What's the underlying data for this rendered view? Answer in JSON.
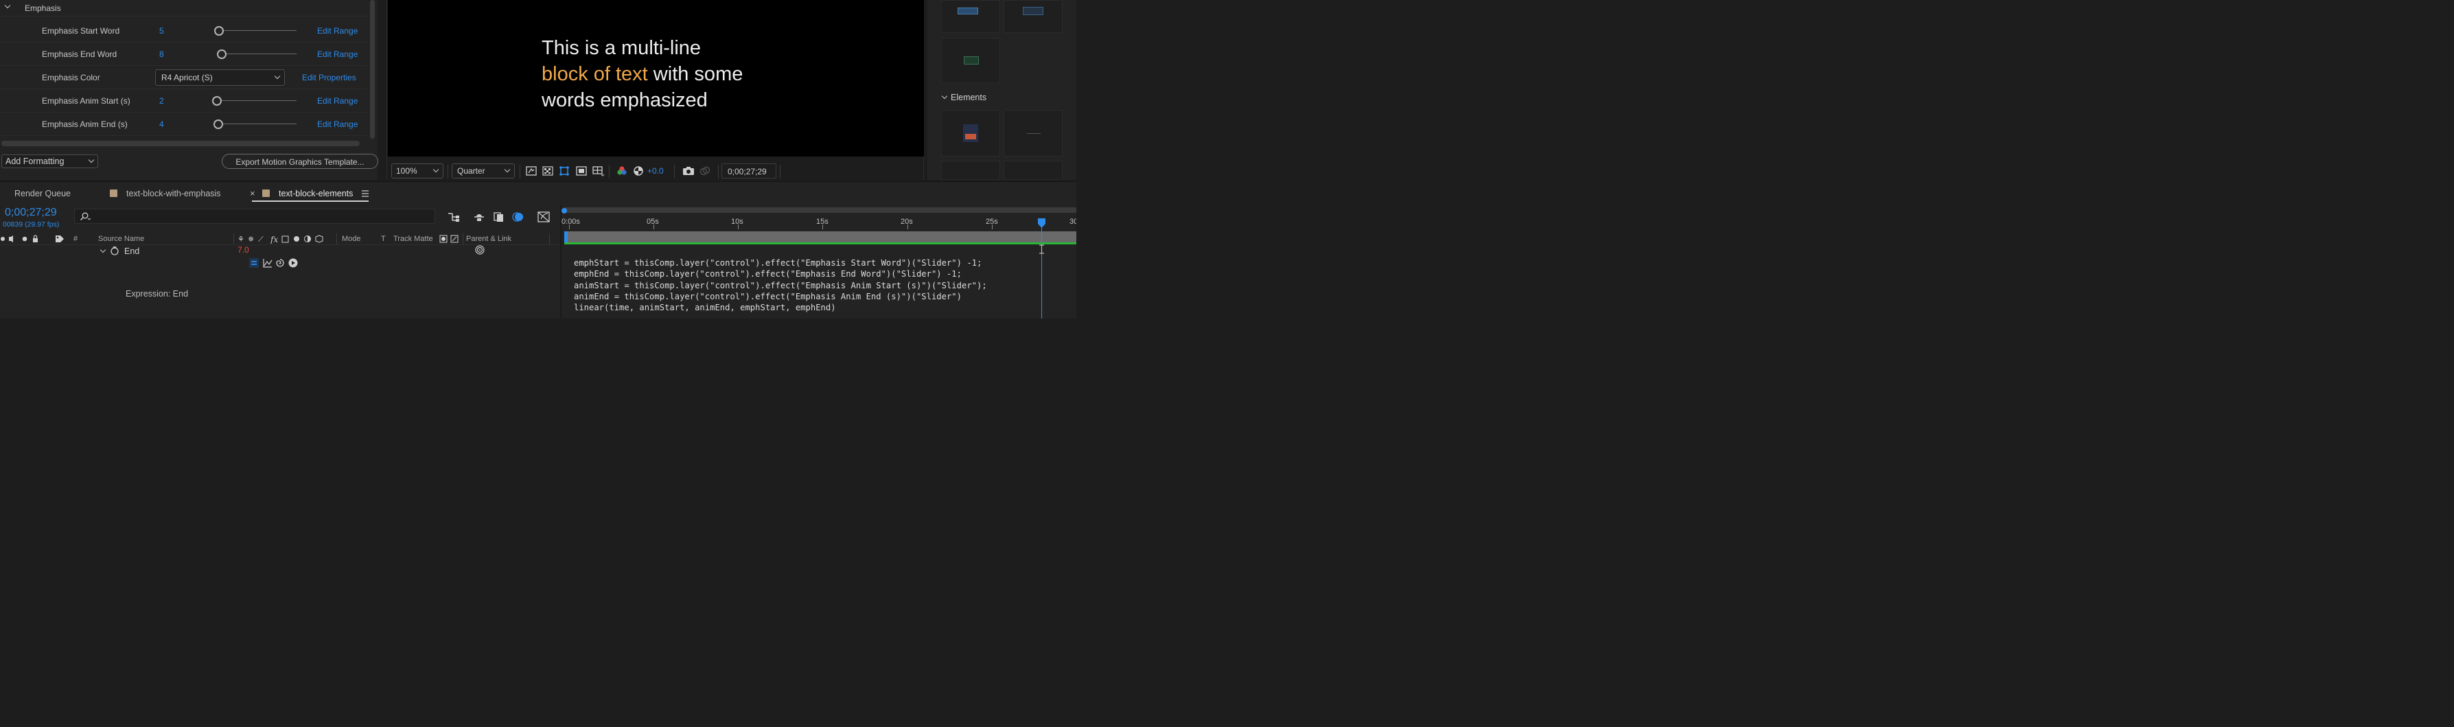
{
  "essential_graphics": {
    "section_label": "Emphasis",
    "rows": [
      {
        "label": "Emphasis Start Word",
        "value": "5",
        "action": "Edit Range",
        "slider": 0.0
      },
      {
        "label": "Emphasis End Word",
        "value": "8",
        "action": "Edit Range",
        "slider": 0.03
      },
      {
        "label": "Emphasis Color",
        "dropdown": "R4 Apricot (S)",
        "action": "Edit Properties"
      },
      {
        "label": "Emphasis Anim Start (s)",
        "value": "2",
        "action": "Edit Range",
        "slider": 0.0
      },
      {
        "label": "Emphasis Anim End (s)",
        "value": "4",
        "action": "Edit Range",
        "slider": 0.0
      }
    ],
    "add_formatting": "Add Formatting",
    "export_button": "Export Motion Graphics Template..."
  },
  "viewer": {
    "text_line1": "This is a multi-line",
    "text_line2_highlight": "block of text",
    "text_line2_rest": " with some",
    "text_line3": "words emphasized",
    "zoom": "100%",
    "resolution": "Quarter",
    "exposure": "+0.0",
    "timecode": "0;00;27;29",
    "highlight_color": "#f1a84a"
  },
  "project_panel": {
    "section_label": "Elements"
  },
  "timeline": {
    "tabs": [
      {
        "label": "Render Queue"
      },
      {
        "label": "text-block-with-emphasis"
      },
      {
        "label": "text-block-elements",
        "active": true
      }
    ],
    "current_time": "0;00;27;29",
    "frame_info": "00839 (29.97 fps)",
    "search_placeholder": "",
    "columns": {
      "hash": "#",
      "source_name": "Source Name",
      "mode": "Mode",
      "t": "T",
      "track_matte": "Track Matte",
      "parent_link": "Parent & Link"
    },
    "property_name": "End",
    "property_value": "7.0",
    "expression_label": "Expression: End",
    "ruler_labels": [
      "0:00s",
      "05s",
      "10s",
      "15s",
      "20s",
      "25s",
      "30"
    ],
    "expression_lines": [
      "emphStart = thisComp.layer(\"control\").effect(\"Emphasis Start Word\")(\"Slider\") -1;",
      "emphEnd = thisComp.layer(\"control\").effect(\"Emphasis End Word\")(\"Slider\") -1;",
      "animStart = thisComp.layer(\"control\").effect(\"Emphasis Anim Start (s)\")(\"Slider\");",
      "animEnd = thisComp.layer(\"control\").effect(\"Emphasis Anim End (s)\")(\"Slider\")",
      "linear(time, animStart, animEnd, emphStart, emphEnd)"
    ],
    "accent_color": "#2d8ceb",
    "work_area_color": "#27b636"
  }
}
